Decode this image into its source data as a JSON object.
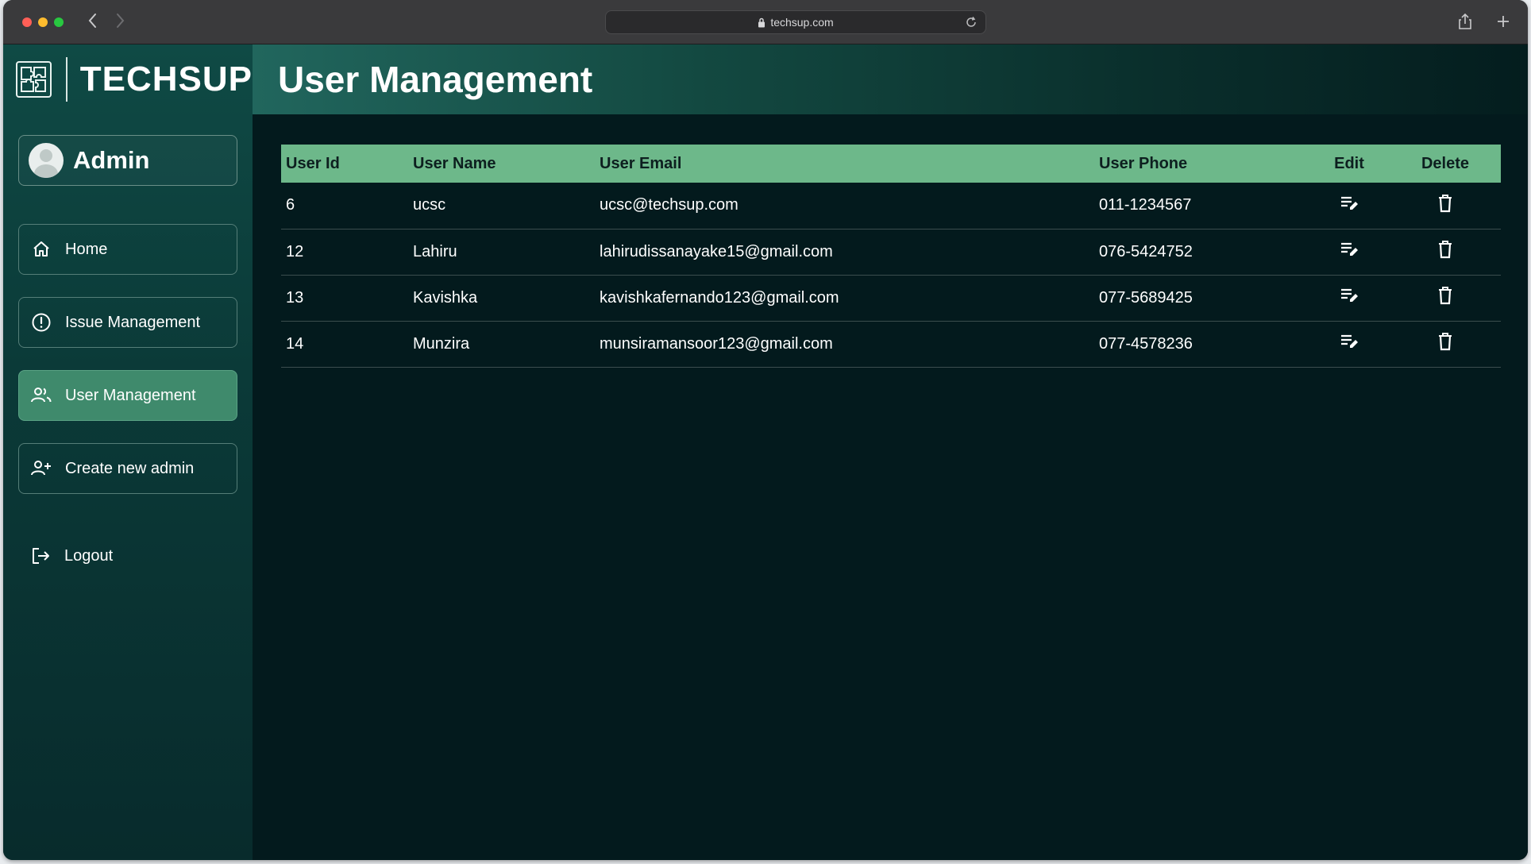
{
  "browser": {
    "url": "techsup.com"
  },
  "brand": {
    "name": "TECHSUP",
    "logo_icon": "puzzle-icon"
  },
  "admin": {
    "name": "Admin"
  },
  "sidebar": {
    "items": [
      {
        "label": "Home",
        "icon": "home-icon"
      },
      {
        "label": "Issue Management",
        "icon": "alert-circle-icon"
      },
      {
        "label": "User Management",
        "icon": "users-icon",
        "active": true
      },
      {
        "label": "Create new admin",
        "icon": "user-plus-icon"
      },
      {
        "label": "Logout",
        "icon": "logout-icon"
      }
    ]
  },
  "page": {
    "title": "User Management"
  },
  "table": {
    "headers": {
      "id": "User Id",
      "name": "User Name",
      "email": "User Email",
      "phone": "User Phone",
      "edit": "Edit",
      "delete": "Delete"
    },
    "rows": [
      {
        "id": "6",
        "name": "ucsc",
        "email": "ucsc@techsup.com",
        "phone": "011-1234567"
      },
      {
        "id": "12",
        "name": "Lahiru",
        "email": "lahirudissanayake15@gmail.com",
        "phone": "076-5424752"
      },
      {
        "id": "13",
        "name": "Kavishka",
        "email": "kavishkafernando123@gmail.com",
        "phone": "077-5689425"
      },
      {
        "id": "14",
        "name": "Munzira",
        "email": "munsiramansoor123@gmail.com",
        "phone": "077-4578236"
      }
    ]
  },
  "colors": {
    "header_green": "#6db88a",
    "active_nav": "#3f8a6c",
    "background": "#031a1d"
  }
}
